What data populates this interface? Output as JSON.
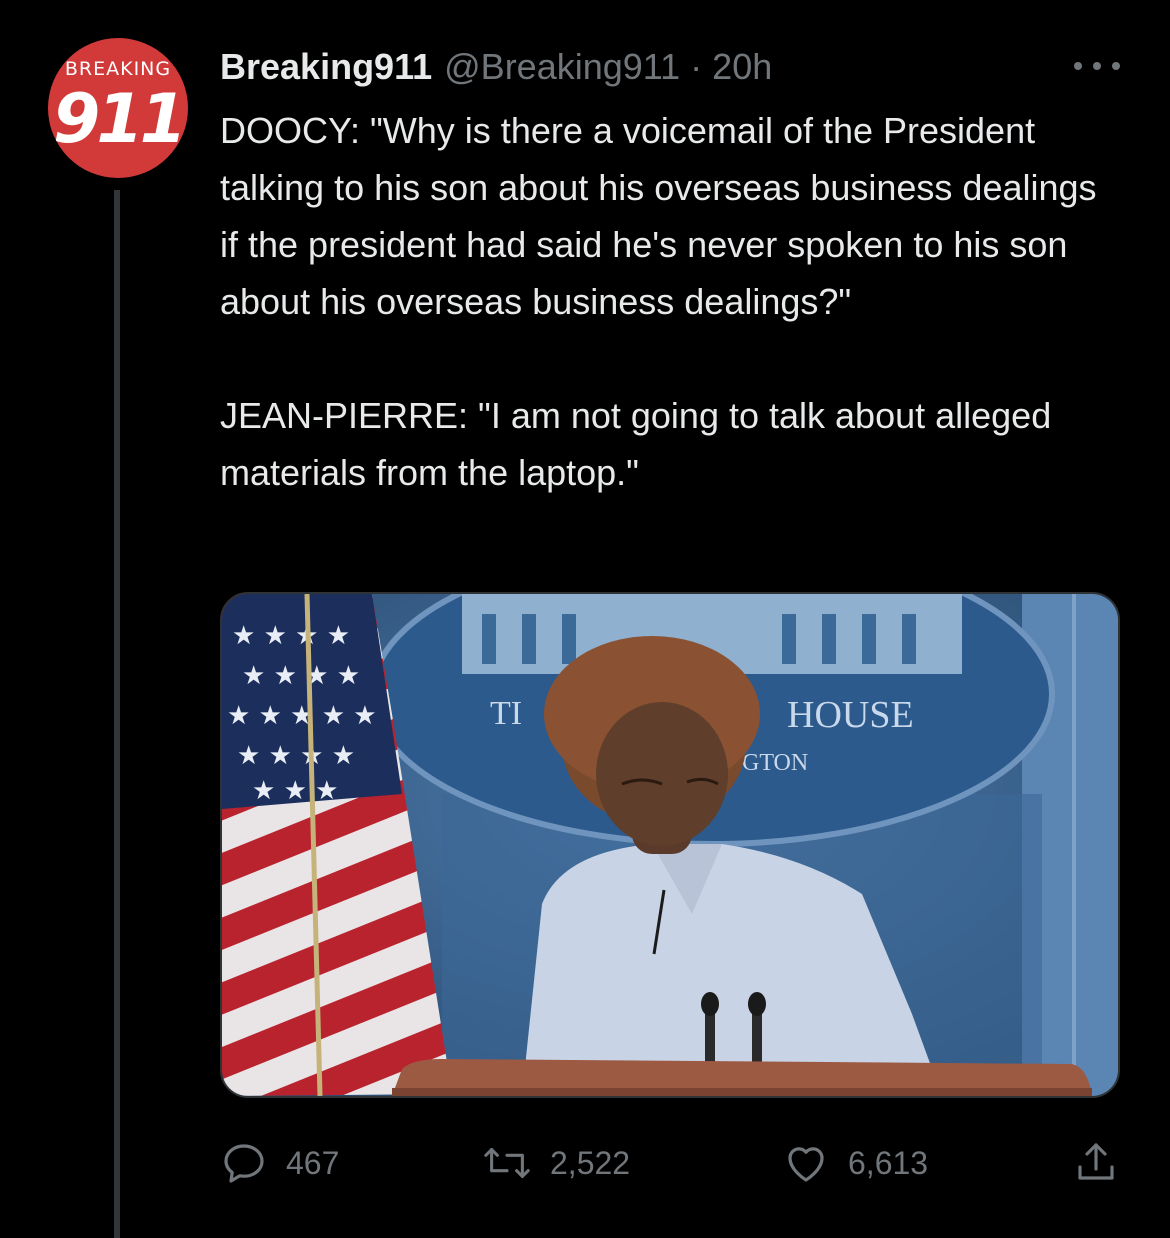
{
  "account": {
    "avatar_top_text": "BREAKING",
    "avatar_main_text": "911",
    "display_name": "Breaking911",
    "handle": "@Breaking911",
    "separator": "·",
    "time": "20h"
  },
  "tweet": {
    "paragraph_1": "DOOCY: \"Why is there a voicemail of the President talking to his son about his overseas business dealings if the president had said he's never spoken to his son about his overseas business dealings?\"",
    "paragraph_2": "JEAN-PIERRE: \"I am not going to talk about alleged materials from the laptop.\""
  },
  "media": {
    "seal_text_left": "TI",
    "seal_text_right": "HOUSE",
    "seal_text_bottom": "GTON"
  },
  "actions": {
    "reply_count": "467",
    "retweet_count": "2,522",
    "like_count": "6,613"
  },
  "icons": {
    "more": "more-horizontal-icon",
    "reply": "reply-icon",
    "retweet": "retweet-icon",
    "like": "heart-icon",
    "share": "share-icon"
  },
  "colors": {
    "background": "#000000",
    "text": "#e7e9ea",
    "secondary": "#71767b",
    "avatar": "#d23a3a",
    "thread_line": "#333639"
  }
}
